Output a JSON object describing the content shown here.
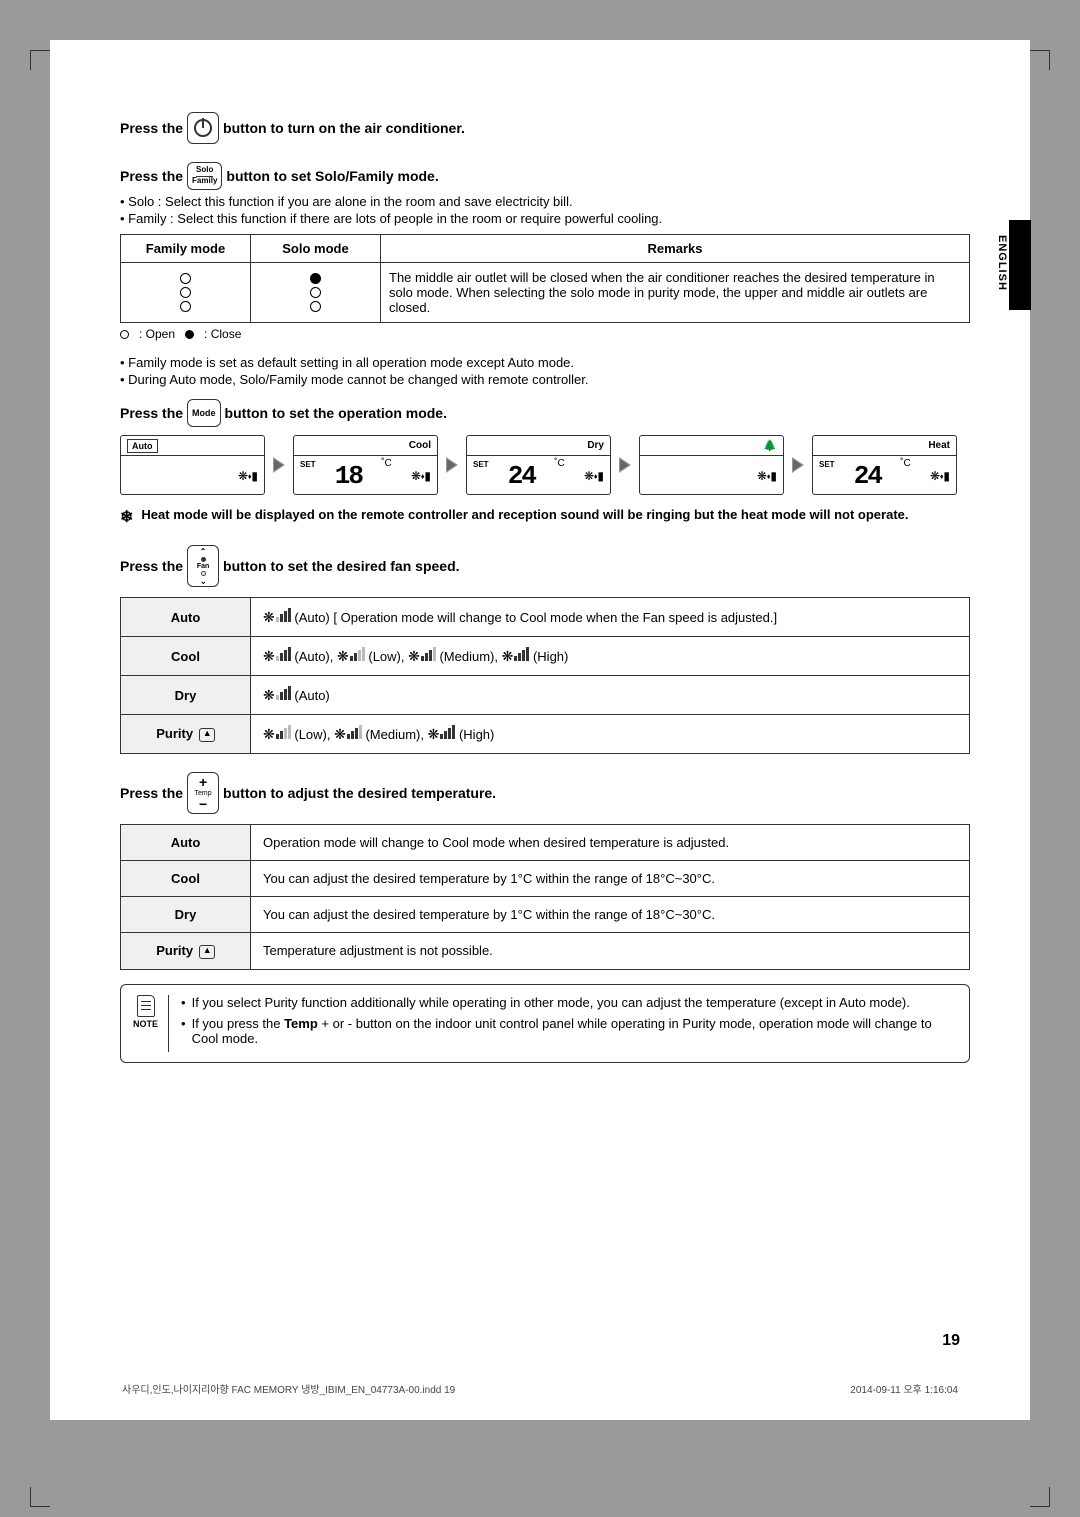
{
  "side": {
    "label": "ENGLISH"
  },
  "sec1": {
    "text_a": "Press the",
    "text_b": "button to turn on the air conditioner."
  },
  "sec2": {
    "text_a": "Press the",
    "btn_top": "Solo",
    "btn_bot": "Family",
    "text_b": "button to set Solo/Family mode.",
    "bullet1": "• Solo : Select this function if you are alone in the room and save electricity bill.",
    "bullet2": "• Family : Select this function if there are lots of people in the room or require powerful cooling."
  },
  "mode_table": {
    "h1": "Family mode",
    "h2": "Solo mode",
    "h3": "Remarks",
    "remarks": "The middle air outlet will be closed when the air conditioner reaches the desired temperature in solo mode. When selecting the solo mode in purity mode, the upper and middle air outlets are closed."
  },
  "legend": {
    "open": ": Open",
    "close": ": Close"
  },
  "notes2": {
    "b1": "• Family mode is set as default setting in all operation mode except Auto mode.",
    "b2": "• During Auto mode, Solo/Family mode cannot be changed with remote controller."
  },
  "sec3": {
    "text_a": "Press the",
    "btn": "Mode",
    "text_b": "button to set the operation mode."
  },
  "lcd": {
    "auto": "Auto",
    "cool": "Cool",
    "dry": "Dry",
    "heat": "Heat",
    "set": "SET",
    "t18": "18",
    "t24a": "24",
    "t24b": "24",
    "unit": "˚C"
  },
  "heat_note": "Heat mode will be displayed on the remote controller and reception sound will be ringing but the heat mode will not operate.",
  "sec4": {
    "text_a": "Press the",
    "btn": "Fan",
    "text_b": "button to set the desired fan speed."
  },
  "fan_table": {
    "r1h": "Auto",
    "r1d": "(Auto) [ Operation mode will change to Cool mode when the Fan speed is adjusted.]",
    "r2h": "Cool",
    "r2d_auto": "(Auto),",
    "r2d_low": "(Low),",
    "r2d_med": "(Medium),",
    "r2d_high": "(High)",
    "r3h": "Dry",
    "r3d": "(Auto)",
    "r4h": "Purity",
    "r4d_low": "(Low),",
    "r4d_med": "(Medium),",
    "r4d_high": "(High)"
  },
  "sec5": {
    "text_a": "Press the",
    "btn": "Temp",
    "text_b": "button to adjust the desired temperature."
  },
  "temp_table": {
    "r1h": "Auto",
    "r1d": "Operation mode will change to Cool mode when desired temperature is adjusted.",
    "r2h": "Cool",
    "r2d": "You can adjust the desired temperature by 1°C  within the range of 18°C~30°C.",
    "r3h": "Dry",
    "r3d": "You can adjust the desired temperature by 1°C  within the range of 18°C~30°C.",
    "r4h": "Purity",
    "r4d": "Temperature adjustment is not possible."
  },
  "note_box": {
    "label": "NOTE",
    "n1": "If you select Purity function additionally while operating in other mode, you can adjust the temperature (except in Auto mode).",
    "n2_a": "If you press the ",
    "n2_b": "Temp",
    "n2_c": " + or - button on the indoor unit control panel while operating in Purity mode, operation mode will change to Cool mode."
  },
  "page_num": "19",
  "footer": {
    "left": "사우디,인도,나이지리아향 FAC MEMORY 냉방_IBIM_EN_04773A-00.indd   19",
    "right": "2014-09-11   오후 1:16:04"
  }
}
